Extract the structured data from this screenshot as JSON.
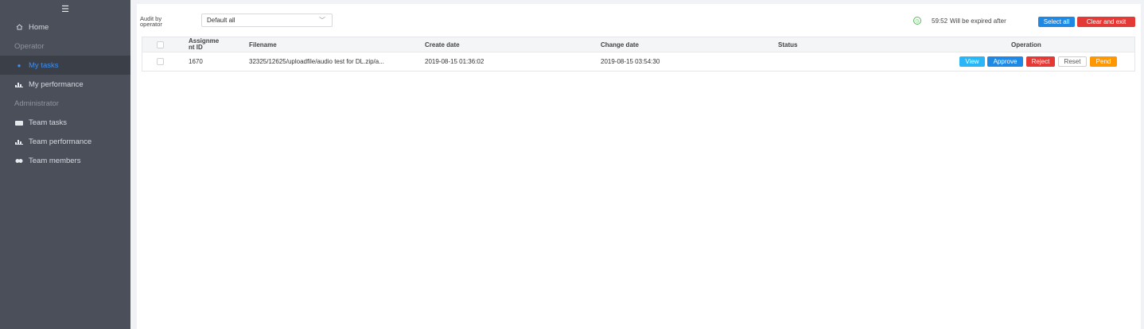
{
  "sidebar": {
    "menu_icon": "☰",
    "items": [
      {
        "label": "Home",
        "icon": "home-icon",
        "type": "item"
      },
      {
        "label": "Operator",
        "type": "section"
      },
      {
        "label": "My tasks",
        "icon": "task-icon",
        "type": "item",
        "active": true
      },
      {
        "label": "My performance",
        "icon": "chart-icon",
        "type": "item"
      },
      {
        "label": "Administrator",
        "type": "section"
      },
      {
        "label": "Team tasks",
        "icon": "folder-icon",
        "type": "item"
      },
      {
        "label": "Team performance",
        "icon": "chart-icon",
        "type": "item"
      },
      {
        "label": "Team members",
        "icon": "group-icon",
        "type": "item"
      }
    ]
  },
  "toolbar": {
    "audit_label_line1": "Audit by",
    "audit_label_line2": "operator",
    "select_value": "Default all",
    "timer_value": "59:52",
    "timer_text": "Will be expired after",
    "select_all_label": "Select all",
    "clear_exit_label": "Clear and exit"
  },
  "table": {
    "headers": {
      "assignment_line1": "Assignme",
      "assignment_line2": "nt ID",
      "filename": "Filename",
      "create_date": "Create date",
      "change_date": "Change date",
      "status": "Status",
      "operation": "Operation"
    },
    "rows": [
      {
        "assignment_id": "1670",
        "filename": "32325/12625/uploadfile/audio test for DL.zip/a...",
        "create_date": "2019-08-15 01:36:02",
        "change_date": "2019-08-15 03:54:30",
        "status": ""
      }
    ],
    "actions": {
      "view": "View",
      "approve": "Approve",
      "reject": "Reject",
      "reset": "Reset",
      "pend": "Pend"
    }
  },
  "colors": {
    "sidebar_bg": "#4a4f59",
    "active_text": "#3f8ff0",
    "blue": "#1e88e5",
    "red": "#e53935",
    "orange": "#ff9800"
  }
}
